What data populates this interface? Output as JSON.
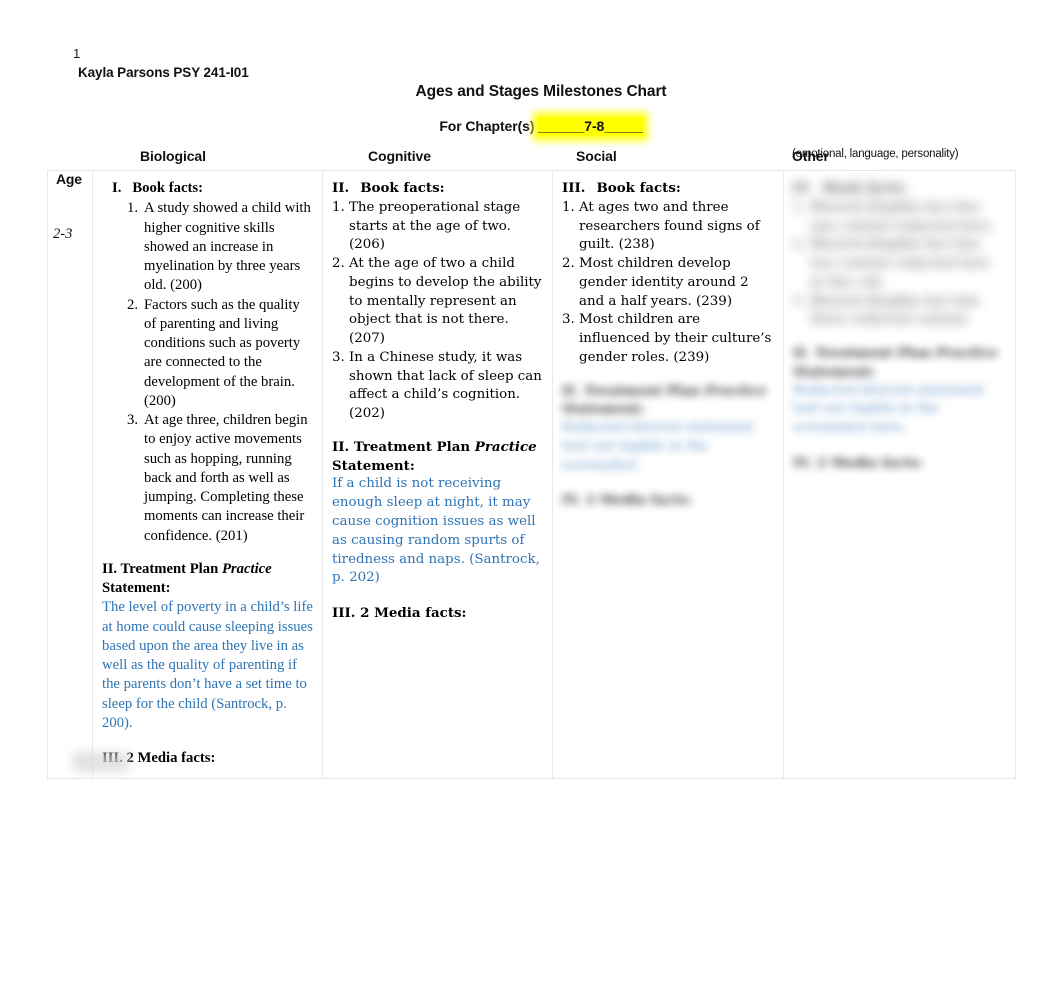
{
  "header": {
    "page_number": "1",
    "byline": "Kayla Parsons PSY 241-I01",
    "title": "Ages and Stages Milestones Chart",
    "chapter_prefix": "For Chapter(s) ",
    "chapter_value": "______7-8_____",
    "highlight_color": "#ffff00"
  },
  "columns": {
    "age": "Age",
    "biological": "Biological",
    "cognitive": "Cognitive",
    "social": "Social",
    "other": "Other",
    "other_sub": "(emotional, language, personality)"
  },
  "row": {
    "age_range": "2-3"
  },
  "biological": {
    "book_facts_num": "I.",
    "book_facts_label": "Book facts:",
    "facts": [
      {
        "num": "1.",
        "text": "A study showed a child with higher cognitive skills showed an increase in myelination by three years old. (200)"
      },
      {
        "num": "2.",
        "text": "Factors such as the quality of parenting and living conditions such as poverty are connected to the development of the brain. (200)"
      },
      {
        "num": "3.",
        "text": "At age three, children begin to enjoy active movements such as hopping, running back and forth as well as jumping. Completing these moments can increase their confidence. (201)"
      }
    ],
    "treatment_head": "II. Treatment Plan ",
    "treatment_practice": "Practice",
    "treatment_statement_label": "Statement:",
    "treatment_statement": "The level of poverty in a child’s life at home could cause sleeping issues based upon the area they live in as well as the quality of parenting if the parents don’t have a set time to sleep for the child (Santrock, p. 200).",
    "media_head": "III. 2 Media facts:"
  },
  "cognitive": {
    "book_facts_num": "II.",
    "book_facts_label": "Book facts:",
    "facts": [
      {
        "num": "1.",
        "text": "The preoperational stage starts at the age of two. (206)"
      },
      {
        "num": "2.",
        "text": "At the age of two a child begins to develop the ability to mentally represent an object that is not there. (207)"
      },
      {
        "num": "3.",
        "text": "In a Chinese study, it was shown that lack of sleep can affect a child’s cognition. (202)"
      }
    ],
    "treatment_head": "II. Treatment Plan ",
    "treatment_practice": "Practice",
    "treatment_statement_label": "Statement:",
    "treatment_statement": "If a child is not receiving enough sleep at night, it may cause cognition issues as well as causing random spurts of tiredness and naps. (Santrock, p. 202)",
    "media_head": "III. 2 Media facts:"
  },
  "social": {
    "book_facts_num": "III.",
    "book_facts_label": "Book facts:",
    "facts": [
      {
        "num": "1.",
        "text": "At ages two and three researchers found signs of guilt. (238)"
      },
      {
        "num": "2.",
        "text": "Most children develop gender identity around 2 and a half years. (239)"
      },
      {
        "num": "3.",
        "text": "Most children are influenced by their culture’s gender roles. (239)"
      }
    ],
    "treatment_head": "II. Treatment Plan ",
    "treatment_practice": "Practice",
    "treatment_statement_label": "Statement:",
    "treatment_statement": "Redacted blurred statement text not legible in the screenshot.",
    "media_head": "IV. 2 Media facts:"
  },
  "other": {
    "book_facts_num": "IV.",
    "book_facts_label": "Book facts:",
    "facts": [
      {
        "num": "1.",
        "text": "Blurred illegible fact line one content redacted here."
      },
      {
        "num": "2.",
        "text": "Blurred illegible fact line two content redacted here in this cell."
      },
      {
        "num": "3.",
        "text": "Blurred illegible fact line three redacted content."
      }
    ],
    "treatment_head": "II. Treatment Plan ",
    "treatment_practice": "Practice",
    "treatment_statement_label": "Statement:",
    "treatment_statement": "Redacted blurred statement text not legible in the screenshot here.",
    "media_head": "IV. 2 Media facts:"
  }
}
